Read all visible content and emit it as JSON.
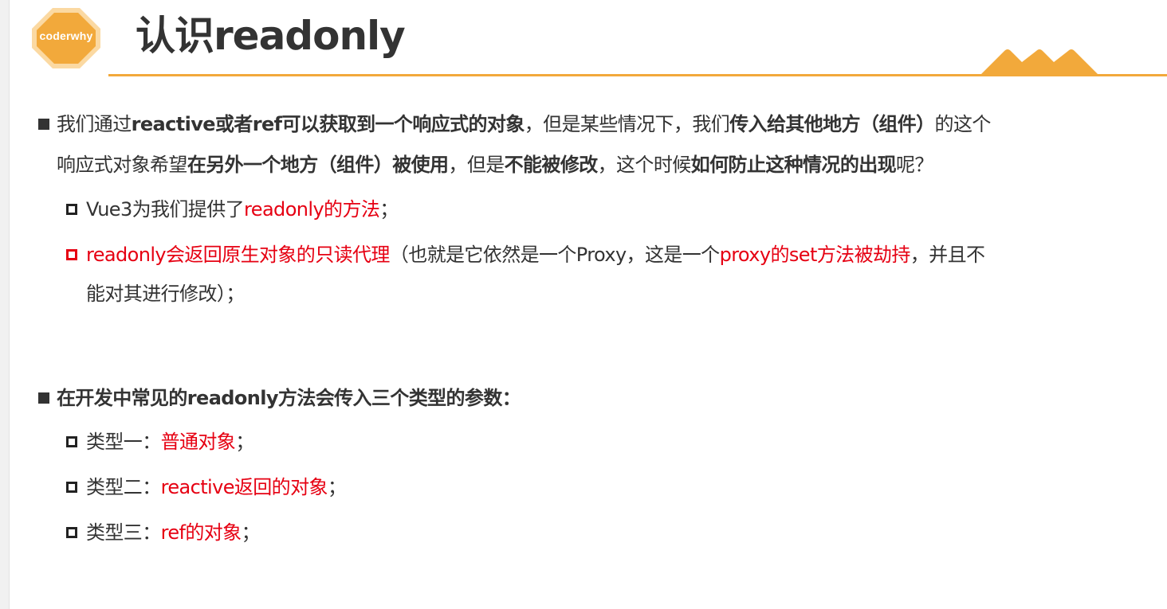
{
  "logo": {
    "text": "coderwhy"
  },
  "title": "认识readonly",
  "colors": {
    "accent": "#f2a93b",
    "highlight": "#e60012",
    "text": "#333333"
  },
  "section1": {
    "line1": [
      "我们通过",
      "reactive或者ref可以获取到一个响应式的对象",
      "，但是某些情况下，我们",
      "传入给其他地方（组件）",
      "的这个"
    ],
    "line2": [
      "响应式对象希望",
      "在另外一个地方（组件）被使用",
      "，但是",
      "不能被修改",
      "，这个时候",
      "如何防止这种情况的出现",
      "呢？"
    ],
    "sub1": [
      "Vue3为我们提供了",
      "readonly的方法",
      "；"
    ],
    "sub2_line1": [
      "readonly会返回原生对象的只读代理",
      "（也就是它依然是一个Proxy，这是一个",
      "proxy的set方法被劫持",
      "，并且不"
    ],
    "sub2_line2": "能对其进行修改）；"
  },
  "section2": {
    "heading": "在开发中常见的readonly方法会传入三个类型的参数：",
    "items": [
      {
        "label": "类型一：",
        "value": "普通对象",
        "end": "；"
      },
      {
        "label": "类型二：",
        "value": "reactive返回的对象",
        "end": "；"
      },
      {
        "label": "类型三：",
        "value": "ref的对象",
        "end": "；"
      }
    ]
  }
}
